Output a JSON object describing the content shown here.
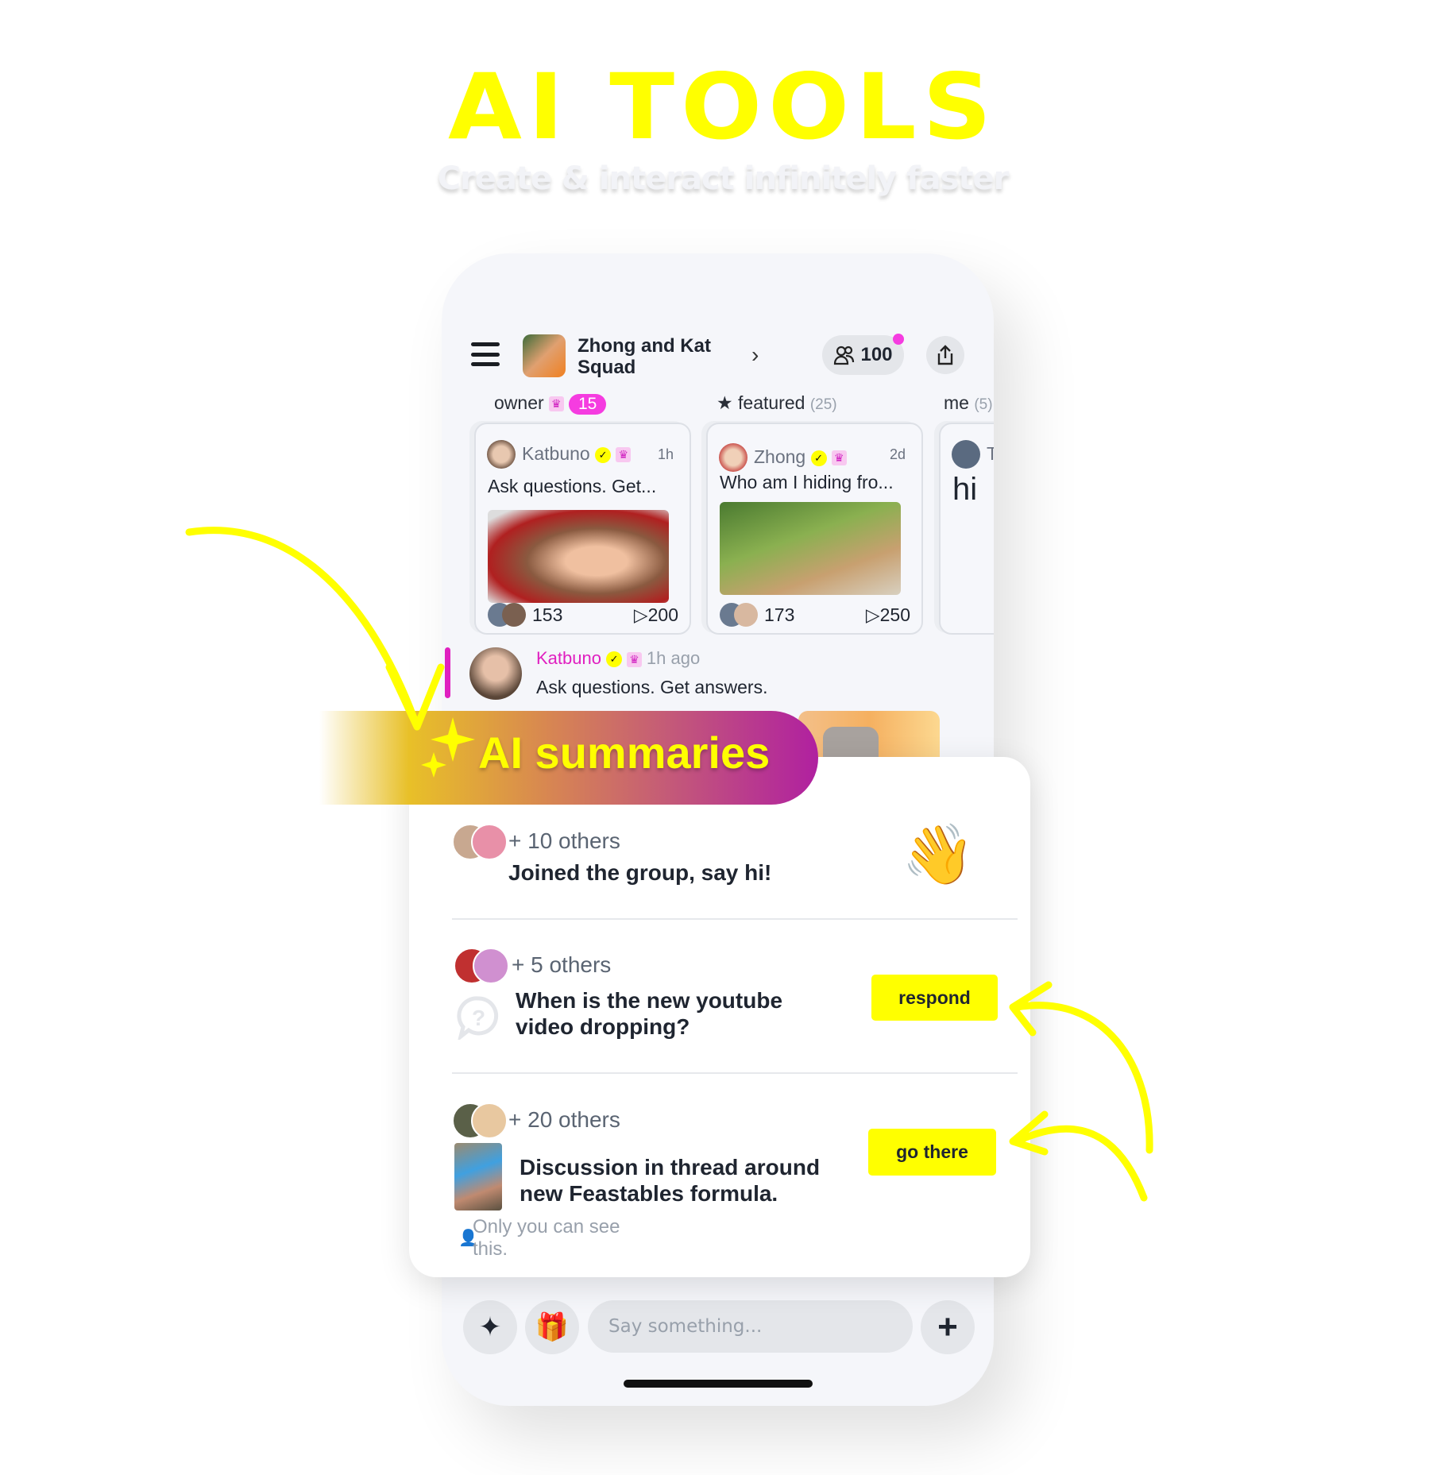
{
  "hero": {
    "title": "AI TOOLS",
    "subtitle": "Create & interact infinitely faster"
  },
  "header": {
    "group_name": "Zhong and Kat Squad",
    "member_count": "100",
    "menu_icon": "hamburger-icon",
    "share_icon": "share-icon",
    "notification_color": "#f53ce0"
  },
  "tabs": [
    {
      "label": "owner",
      "badge": "15"
    },
    {
      "label": "featured",
      "count": "(25)"
    },
    {
      "label": "me",
      "count": "(5)"
    }
  ],
  "cards": [
    {
      "author": "Katbuno",
      "time": "1h",
      "text": "Ask questions. Get...",
      "likes": "153",
      "views": "200"
    },
    {
      "author": "Zhong",
      "time": "2d",
      "text": "Who am I hiding fro...",
      "likes": "173",
      "views": "250"
    },
    {
      "author": "T",
      "text": "hi"
    }
  ],
  "comment": {
    "author": "Katbuno",
    "time": "1h ago",
    "text": "Ask questions. Get answers."
  },
  "banner": {
    "label": "AI summaries"
  },
  "summaries": [
    {
      "others": "+ 10 others",
      "text": "Joined the group, say hi!",
      "emoji": "👋"
    },
    {
      "others": "+ 5 others",
      "text": "When is the new youtube video dropping?",
      "button": "respond"
    },
    {
      "others": "+ 20 others",
      "text": "Discussion in thread around new Feastables formula.",
      "button": "go there",
      "note": "Only you can see this."
    }
  ],
  "composer": {
    "placeholder": "Say something..."
  },
  "colors": {
    "accent_yellow": "#ffff00",
    "accent_pink": "#e020c0",
    "phone_bg": "#f5f6fa"
  }
}
